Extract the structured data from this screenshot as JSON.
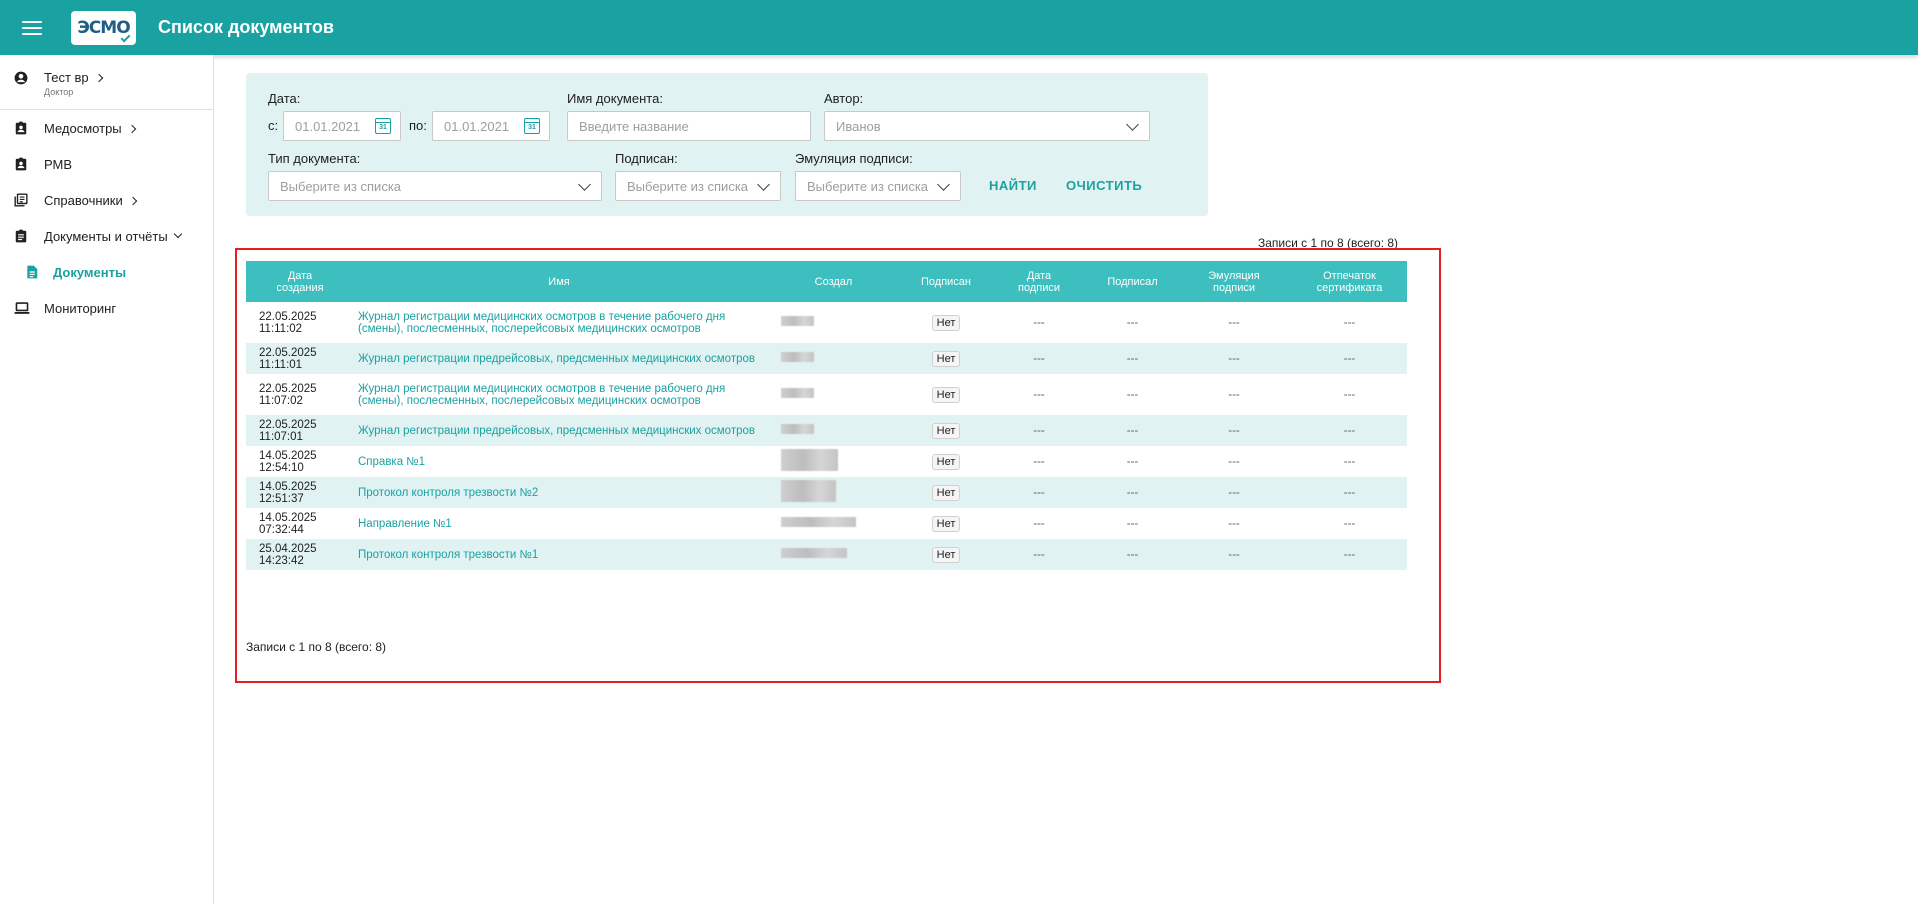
{
  "header": {
    "title": "Список документов",
    "logo_text": "ЭСМО",
    "menu_icon": "hamburger-menu-icon"
  },
  "sidebar": {
    "user": {
      "name": "Тест вр",
      "role": "Доктор",
      "icon": "account-circle-icon"
    },
    "items": [
      {
        "label": "Медосмотры",
        "icon": "clipboard-account-icon"
      },
      {
        "label": "РМВ",
        "icon": "clipboard-account-icon"
      },
      {
        "label": "Справочники",
        "icon": "book-list-icon"
      },
      {
        "label": "Документы и отчёты",
        "icon": "clipboard-text-icon"
      },
      {
        "label": "Документы",
        "icon": "document-icon"
      },
      {
        "label": "Мониторинг",
        "icon": "laptop-icon"
      }
    ]
  },
  "filter": {
    "date_label": "Дата:",
    "from_label": "с:",
    "to_label": "по:",
    "date_from": "01.01.2021",
    "date_to": "01.01.2021",
    "calendar_day": "31",
    "name_label": "Имя документа:",
    "name_placeholder": "Введите название",
    "author_label": "Автор:",
    "author_value": "Иванов",
    "type_label": "Тип документа:",
    "type_placeholder": "Выберите из списка",
    "signed_label": "Подписан:",
    "signed_placeholder": "Выберите из списка",
    "emulation_label": "Эмуляция подписи:",
    "emulation_placeholder": "Выберите из списка",
    "find_button": "НАЙТИ",
    "clear_button": "ОЧИСТИТЬ"
  },
  "records_info": "Записи с 1 по 8 (всего: 8)",
  "table": {
    "columns": [
      "Дата\nсоздания",
      "Имя",
      "Создал",
      "Подписан",
      "Дата\nподписи",
      "Подписал",
      "Эмуляция\nподписи",
      "Отпечаток\nсертификата"
    ],
    "rows": [
      {
        "date": "22.05.2025",
        "time": "11:11:02",
        "name": "Журнал регистрации медицинских осмотров в течение рабочего дня (смены), послесменных, послерейсовых медицинских осмотров",
        "signed": "Нет",
        "sign_date": "---",
        "signer": "---",
        "emulation": "---",
        "fingerprint": "---"
      },
      {
        "date": "22.05.2025",
        "time": "11:11:01",
        "name": "Журнал регистрации предрейсовых, предсменных медицинских осмотров",
        "signed": "Нет",
        "sign_date": "---",
        "signer": "---",
        "emulation": "---",
        "fingerprint": "---"
      },
      {
        "date": "22.05.2025",
        "time": "11:07:02",
        "name": "Журнал регистрации медицинских осмотров в течение рабочего дня (смены), послесменных, послерейсовых медицинских осмотров",
        "signed": "Нет",
        "sign_date": "---",
        "signer": "---",
        "emulation": "---",
        "fingerprint": "---"
      },
      {
        "date": "22.05.2025",
        "time": "11:07:01",
        "name": "Журнал регистрации предрейсовых, предсменных медицинских осмотров",
        "signed": "Нет",
        "sign_date": "---",
        "signer": "---",
        "emulation": "---",
        "fingerprint": "---"
      },
      {
        "date": "14.05.2025",
        "time": "12:54:10",
        "name": "Справка №1",
        "signed": "Нет",
        "sign_date": "---",
        "signer": "---",
        "emulation": "---",
        "fingerprint": "---"
      },
      {
        "date": "14.05.2025",
        "time": "12:51:37",
        "name": "Протокол контроля трезвости №2",
        "signed": "Нет",
        "sign_date": "---",
        "signer": "---",
        "emulation": "---",
        "fingerprint": "---"
      },
      {
        "date": "14.05.2025",
        "time": "07:32:44",
        "name": "Направление №1",
        "signed": "Нет",
        "sign_date": "---",
        "signer": "---",
        "emulation": "---",
        "fingerprint": "---"
      },
      {
        "date": "25.04.2025",
        "time": "14:23:42",
        "name": "Протокол контроля трезвости №1",
        "signed": "Нет",
        "sign_date": "---",
        "signer": "---",
        "emulation": "---",
        "fingerprint": "---"
      }
    ]
  }
}
